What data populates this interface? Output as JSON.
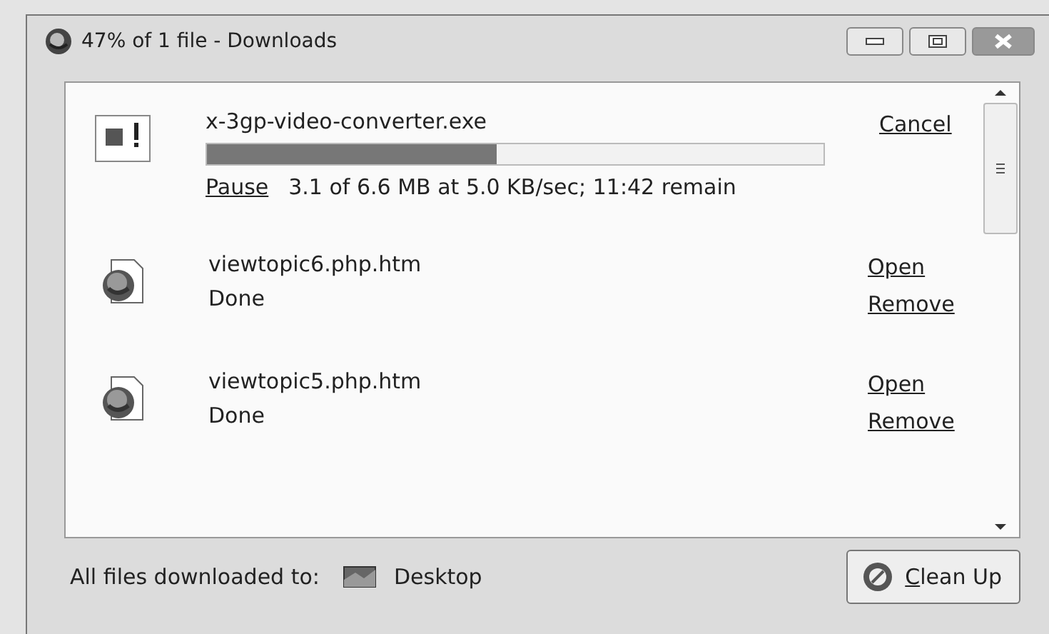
{
  "window": {
    "title": "47% of 1 file - Downloads"
  },
  "downloads": [
    {
      "kind": "active",
      "name": "x-3gp-video-converter.exe",
      "level": 0.47,
      "pause": "Pause",
      "status": "3.1 of 6.6 MB at 5.0 KB/sec; 11:42 remain",
      "actions": [
        "Cancel"
      ]
    },
    {
      "kind": "done",
      "name": "viewtopic6.php.htm",
      "status": "Done",
      "actions": [
        "Open",
        "Remove"
      ]
    },
    {
      "kind": "done",
      "name": "viewtopic5.php.htm",
      "status": "Done",
      "actions": [
        "Open",
        "Remove"
      ]
    }
  ],
  "footer": {
    "label": "All files downloaded to:",
    "folder": "Desktop",
    "button": {
      "label": "Clean Up",
      "access_key_underlined": true
    }
  }
}
